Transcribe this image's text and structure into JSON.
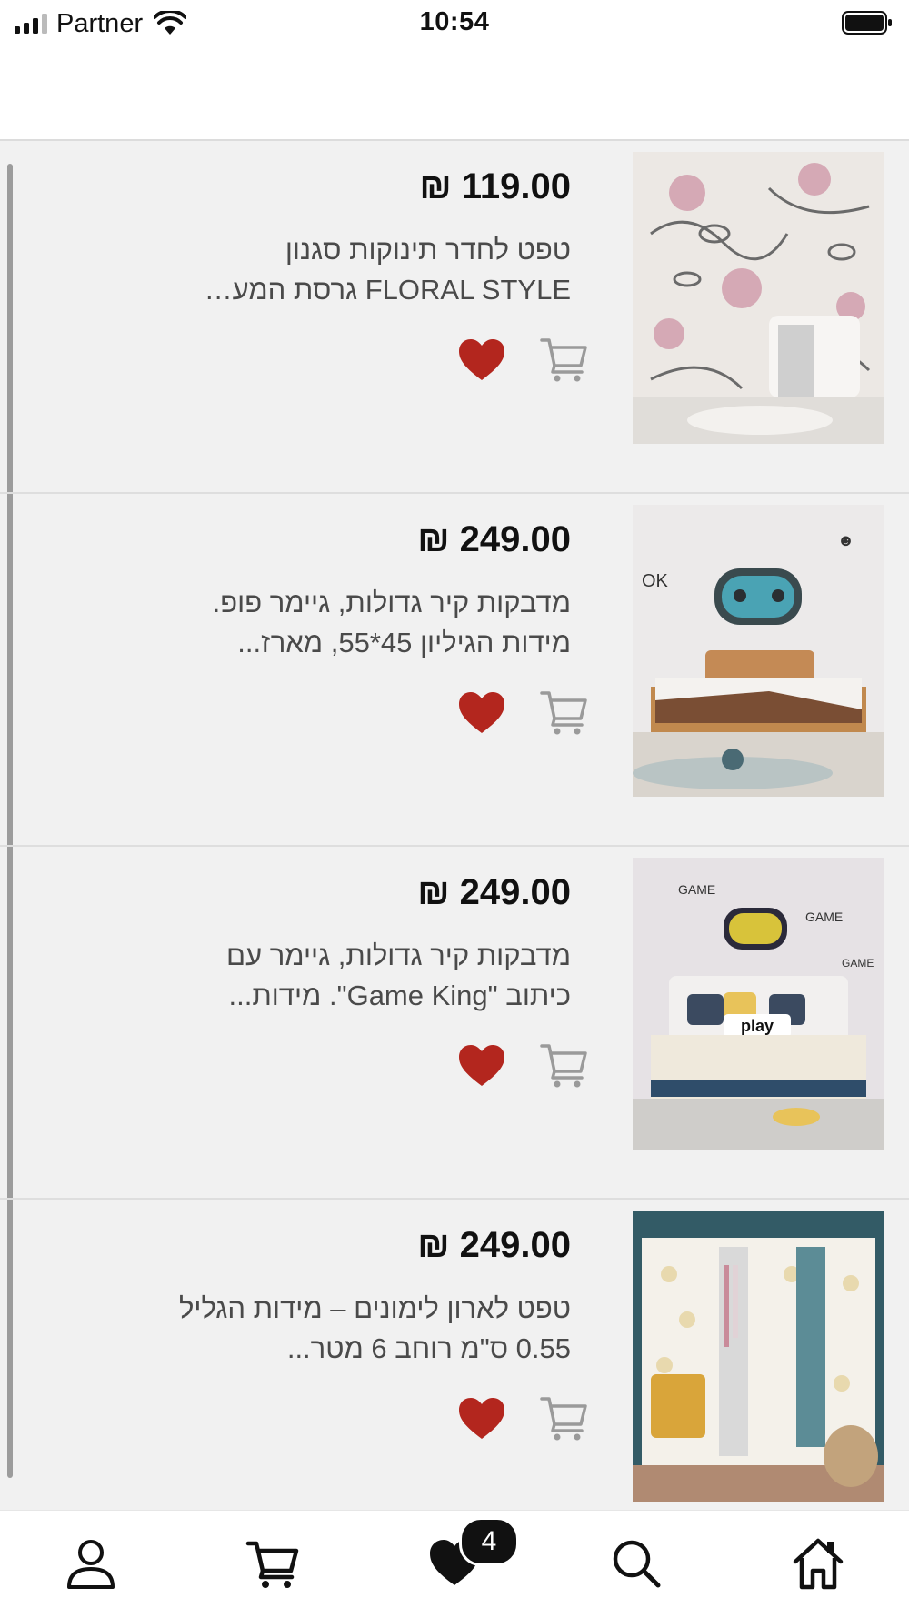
{
  "status_bar": {
    "carrier": "Partner",
    "time": "10:54"
  },
  "currency_symbol": "₪",
  "items": [
    {
      "price": "₪ 119.00",
      "description": "טפט לחדר תינוקות סגנון FLORAL STYLE גרסת המע…",
      "favorited": true,
      "image_subject": "floral wallpaper nursery"
    },
    {
      "price": "₪ 249.00",
      "description": "מדבקות קיר גדולות, גיימר פופ. מידות הגיליון 45*55, מארז...",
      "favorited": true,
      "image_subject": "gamer pop wall stickers bedroom"
    },
    {
      "price": "₪ 249.00",
      "description": "מדבקות קיר גדולות, גיימר עם כיתוב \"Game King\". מידות...",
      "favorited": true,
      "image_subject": "game king wall stickers bedroom",
      "pillow_text": "play"
    },
    {
      "price": "₪ 249.00",
      "description": "טפט לארון לימונים – מידות הגליל 0.55 ס\"מ רוחב 6 מטר...",
      "favorited": true,
      "image_subject": "lemon wallpaper wardrobe"
    }
  ],
  "tab_bar": {
    "favorites_badge": "4",
    "tabs": [
      "profile-icon",
      "cart-icon",
      "heart-icon",
      "search-icon",
      "home-icon"
    ]
  },
  "colors": {
    "heart": "#b3261e",
    "cart_icon": "#9a9a9a",
    "list_background": "#f1f1f1"
  }
}
